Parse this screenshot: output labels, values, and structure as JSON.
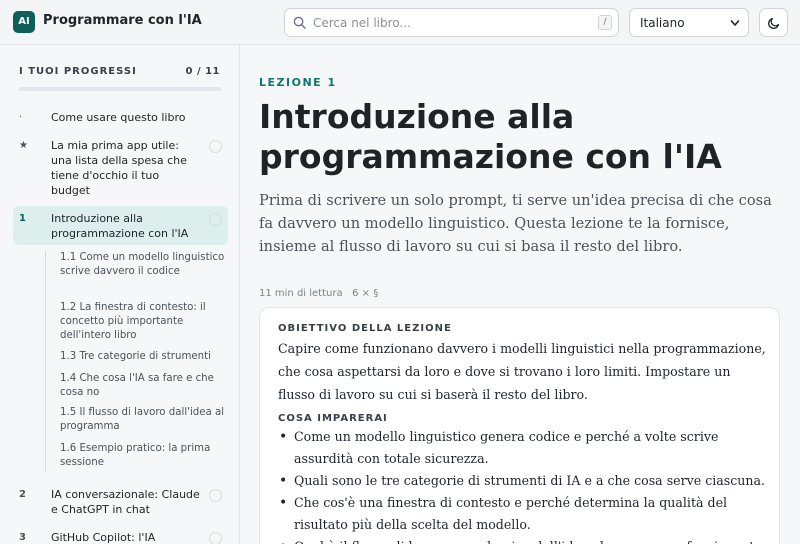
{
  "header": {
    "logo": "AI",
    "brand": "Programmare con l'IA",
    "search_placeholder": "Cerca nel libro...",
    "search_shortcut": "/",
    "language": "Italiano"
  },
  "sidebar": {
    "progress_title": "I TUOI PROGRESSI",
    "progress_count": "0 / 11",
    "progress_fraction": 0,
    "items": [
      {
        "marker": "·",
        "label": "Come usare questo libro"
      },
      {
        "marker": "★",
        "label": "La mia prima app utile: una lista della spesa che tiene d'occhio il tuo budget"
      },
      {
        "marker": "1",
        "label": "Introduzione alla programmazione con l'IA"
      },
      {
        "marker": "2",
        "label": "IA conversazionale: Claude e ChatGPT in chat"
      },
      {
        "marker": "3",
        "label": "GitHub Copilot: l'IA"
      }
    ],
    "subitems": [
      "1.1  Come un modello linguistico scrive davvero il codice",
      "1.2  La finestra di contesto: il concetto più importante dell'intero libro",
      "1.3  Tre categorie di strumenti",
      "1.4  Che cosa l'IA sa fare e che cosa no",
      "1.5  Il flusso di lavoro dall'idea al programma",
      "1.6  Esempio pratico: la prima sessione"
    ]
  },
  "main": {
    "eyebrow": "LEZIONE 1",
    "title": "Introduzione alla programmazione con l'IA",
    "lead": "Prima di scrivere un solo prompt, ti serve un'idea precisa di che cosa fa davvero un modello linguistico. Questa lezione te la fornisce, insieme al flusso di lavoro su cui si basa il resto del libro.",
    "meta": "11 min di lettura   6 × §",
    "objective_title": "OBIETTIVO DELLA LEZIONE",
    "objective_text": "Capire come funzionano davvero i modelli linguistici nella programmazione, che cosa aspettarsi da loro e dove si trovano i loro limiti. Impostare un flusso di lavoro su cui si baserà il resto del libro.",
    "learn_title": "COSA IMPARERAI",
    "learn_items": [
      "Come un modello linguistico genera codice e perché a volte scrive assurdità con totale sicurezza.",
      "Quali sono le tre categorie di strumenti di IA e a che cosa serve ciascuna.",
      "Che cos'è una finestra di contesto e perché determina la qualità del risultato più della scelta del modello.",
      "Qual è il flusso di lavoro complessivo dall'idea al programma funzionante."
    ]
  }
}
